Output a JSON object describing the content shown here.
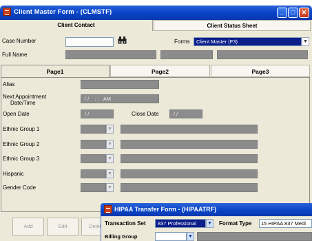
{
  "window": {
    "title": "Client Master Form - (CLMSTF)"
  },
  "top_tabs": [
    "Client Contact",
    "Client Status Sheet"
  ],
  "fields": {
    "case_number_label": "Case Number",
    "case_number_value": "",
    "forms_label": "Forms",
    "forms_value": "Client Master (F3)",
    "full_name_label": "Full Name"
  },
  "page_tabs": [
    "Page1",
    "Page2",
    "Page3"
  ],
  "page1": {
    "alias_label": "Alias",
    "next_appt_label_1": "Next Appointment",
    "next_appt_label_2": "Date/Time",
    "next_appt_date": "/ /",
    "next_appt_time": ": :",
    "next_appt_ampm": "AM",
    "open_date_label": "Open Date",
    "open_date_value": "/ /",
    "close_date_label": "Close Date",
    "close_date_value": "/ /",
    "ethnic1_label": "Ethnic Group 1",
    "ethnic2_label": "Ethnic Group 2",
    "ethnic3_label": "Ethnic Group 3",
    "hispanic_label": "Hispanic",
    "gender_label": "Gender Code"
  },
  "bottom_buttons": [
    "Add",
    "Edit",
    "Delet"
  ],
  "hipaa": {
    "title": "HIPAA Transfer Form - (HIPAATRF)",
    "transaction_set_label": "Transaction Set",
    "transaction_set_value": "837 Professional",
    "format_type_label": "Format Type",
    "format_type_value": "15 HIPAA 837 Medi",
    "billing_group_label": "Billing Group"
  },
  "icons": [
    "app-icon",
    "minimize-icon",
    "maximize-icon",
    "close-icon",
    "binoculars-icon",
    "chevron-down-icon"
  ],
  "colors": {
    "titlebar": "#0a46c8",
    "window_bg": "#ece9d8",
    "field_gray": "#8c8c8c",
    "select_blue": "#0c1e8a"
  }
}
